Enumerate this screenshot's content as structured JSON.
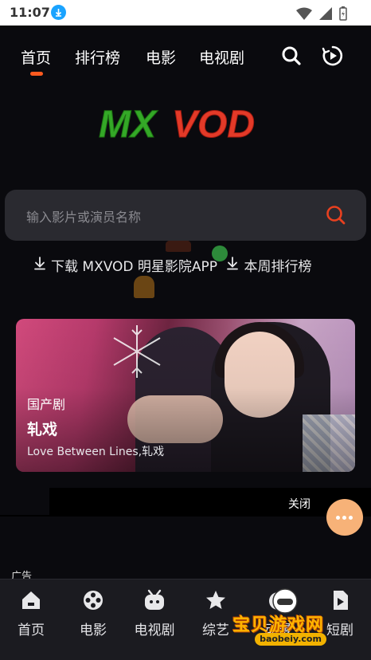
{
  "status_bar": {
    "time": "11:07"
  },
  "top_nav": {
    "tabs": [
      {
        "label": "首页",
        "active": true
      },
      {
        "label": "排行榜"
      },
      {
        "label": "电影"
      },
      {
        "label": "电视剧"
      }
    ],
    "accent_color": "#ff5a1f"
  },
  "logo": {
    "text": "MXVOD"
  },
  "search": {
    "placeholder": "输入影片或演员名称",
    "icon": "search-icon"
  },
  "links": {
    "download_app": "下载 MXVOD 明星影院APP",
    "weekly_ranking": "本周排行榜"
  },
  "banner": {
    "category": "国产剧",
    "title": "轧戏",
    "subtitle": "Love Between Lines,轧戏"
  },
  "ad": {
    "close_label": "关闭",
    "ad_label": "广告"
  },
  "fab": {
    "icon": "more-dots-icon",
    "color": "#f7b278"
  },
  "bottom_nav": {
    "items": [
      {
        "label": "首页",
        "icon": "home-icon"
      },
      {
        "label": "电影",
        "icon": "film-reel-icon"
      },
      {
        "label": "电视剧",
        "icon": "tv-icon"
      },
      {
        "label": "综艺",
        "icon": "star-icon"
      },
      {
        "label": "动漫",
        "icon": "anime-icon"
      },
      {
        "label": "短剧",
        "icon": "short-video-icon"
      }
    ]
  },
  "watermark": {
    "text": "宝贝游戏网",
    "url": "baobeiy.com"
  }
}
